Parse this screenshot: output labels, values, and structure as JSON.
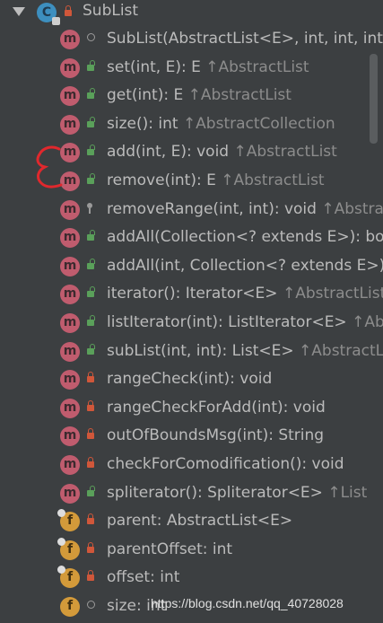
{
  "root": {
    "label": "SubList",
    "class_icon_letter": "C"
  },
  "rows": [
    {
      "kind": "m",
      "vis": "package",
      "name": "SubList(AbstractList<E>, int, int, int)",
      "origin": ""
    },
    {
      "kind": "m",
      "vis": "public",
      "name": "set(int, E): E",
      "origin": "↑AbstractList"
    },
    {
      "kind": "m",
      "vis": "public",
      "name": "get(int): E",
      "origin": "↑AbstractList"
    },
    {
      "kind": "m",
      "vis": "public",
      "name": "size(): int",
      "origin": "↑AbstractCollection"
    },
    {
      "kind": "m",
      "vis": "public",
      "name": "add(int, E): void",
      "origin": "↑AbstractList"
    },
    {
      "kind": "m",
      "vis": "public",
      "name": "remove(int): E",
      "origin": "↑AbstractList"
    },
    {
      "kind": "m",
      "vis": "protected",
      "name": "removeRange(int, int): void",
      "origin": "↑AbstractList"
    },
    {
      "kind": "m",
      "vis": "public",
      "name": "addAll(Collection<? extends E>): boolean",
      "origin": ""
    },
    {
      "kind": "m",
      "vis": "public",
      "name": "addAll(int, Collection<? extends E>): boolean",
      "origin": ""
    },
    {
      "kind": "m",
      "vis": "public",
      "name": "iterator(): Iterator<E>",
      "origin": "↑AbstractList"
    },
    {
      "kind": "m",
      "vis": "public",
      "name": "listIterator(int): ListIterator<E>",
      "origin": "↑AbstractList"
    },
    {
      "kind": "m",
      "vis": "public",
      "name": "subList(int, int): List<E>",
      "origin": "↑AbstractList"
    },
    {
      "kind": "m",
      "vis": "private",
      "name": "rangeCheck(int): void",
      "origin": ""
    },
    {
      "kind": "m",
      "vis": "private",
      "name": "rangeCheckForAdd(int): void",
      "origin": ""
    },
    {
      "kind": "m",
      "vis": "private",
      "name": "outOfBoundsMsg(int): String",
      "origin": ""
    },
    {
      "kind": "m",
      "vis": "private",
      "name": "checkForComodification(): void",
      "origin": ""
    },
    {
      "kind": "m",
      "vis": "public",
      "name": "spliterator(): Spliterator<E>",
      "origin": "↑List"
    },
    {
      "kind": "f",
      "vis": "private",
      "final": true,
      "name": "parent: AbstractList<E>",
      "origin": ""
    },
    {
      "kind": "f",
      "vis": "private",
      "final": true,
      "name": "parentOffset: int",
      "origin": ""
    },
    {
      "kind": "f",
      "vis": "private",
      "final": true,
      "name": "offset: int",
      "origin": ""
    },
    {
      "kind": "f",
      "vis": "package",
      "final": false,
      "name": "size: int",
      "origin": ""
    }
  ],
  "watermark": "https://blog.csdn.net/qq_40728028",
  "colors": {
    "background": "#3c3f41",
    "method_icon": "#c05c6e",
    "field_icon": "#d39a3a",
    "annotation": "#e0282d"
  }
}
